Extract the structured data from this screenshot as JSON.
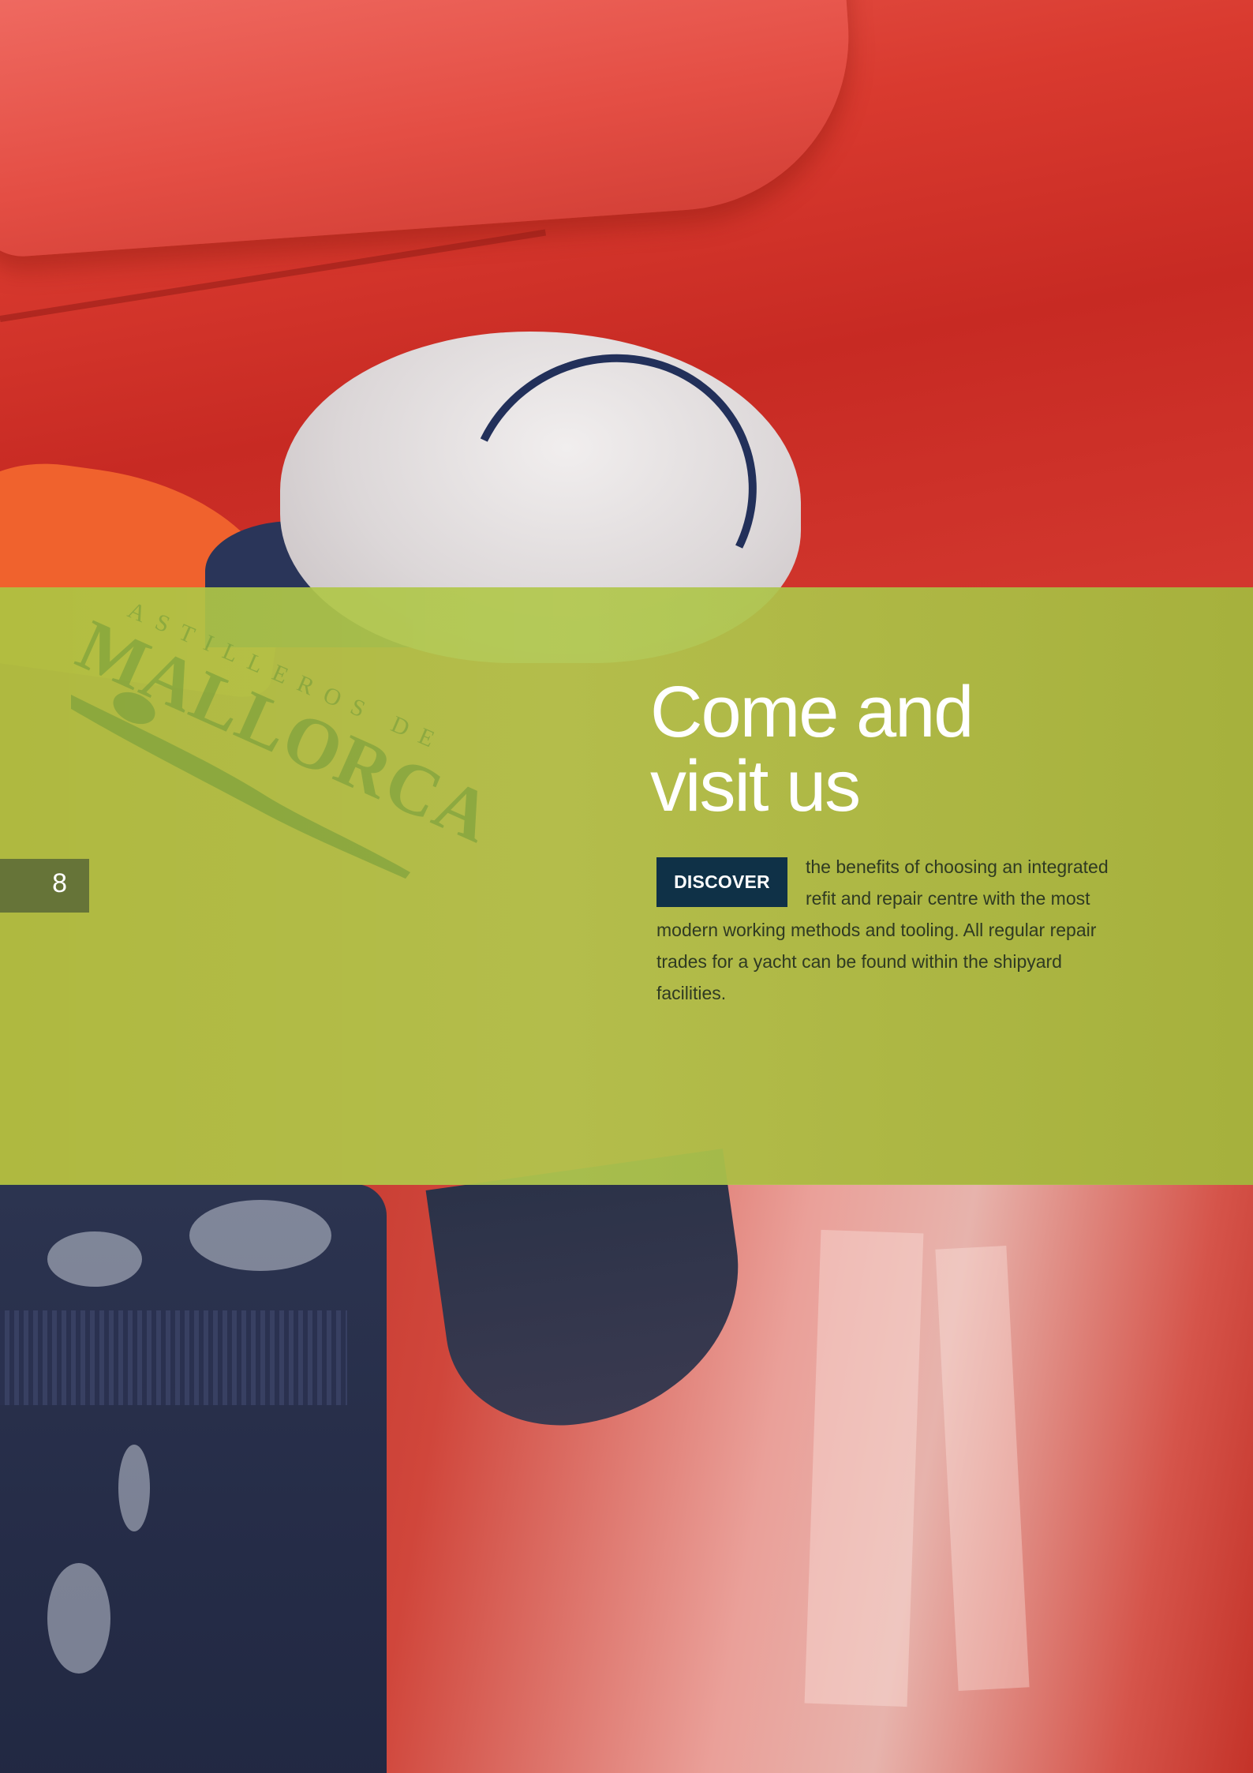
{
  "page": {
    "number": "8"
  },
  "logo": {
    "arc_text": "ASTILLEROS DE",
    "main_text": "MALLORCA"
  },
  "hero": {
    "headline_line1": "Come and",
    "headline_line2": "visit us"
  },
  "cta": {
    "label": "DISCOVER"
  },
  "body": {
    "text": "the benefits of choosing an integrated refit and repair centre with the most modern working methods and tooling. All regular repair trades for a yacht can be found within the shipyard facilities."
  },
  "colors": {
    "band": "#acc442",
    "button": "#0f3147",
    "hull_red": "#c9352a",
    "suit_navy": "#252c47"
  }
}
